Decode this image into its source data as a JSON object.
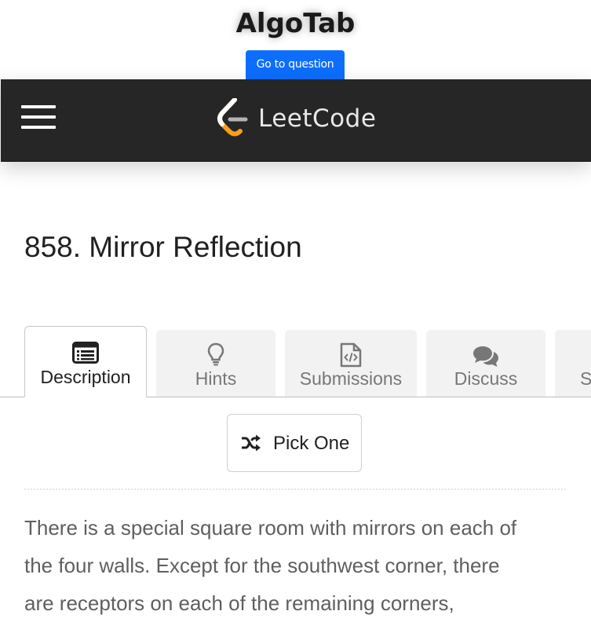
{
  "app": {
    "title": "AlgoTab",
    "goto_label": "Go to question"
  },
  "header": {
    "logo_text": "LeetCode",
    "menu_icon": "hamburger-menu-icon"
  },
  "problem": {
    "title": "858. Mirror Reflection"
  },
  "tabs": [
    {
      "label": "Description",
      "icon": "list-alt-icon",
      "active": true
    },
    {
      "label": "Hints",
      "icon": "lightbulb-icon",
      "active": false
    },
    {
      "label": "Submissions",
      "icon": "file-code-icon",
      "active": false
    },
    {
      "label": "Discuss",
      "icon": "comments-icon",
      "active": false
    },
    {
      "label": "S",
      "icon": "",
      "active": false
    }
  ],
  "pick_one": {
    "label": "Pick One",
    "icon": "shuffle-icon"
  },
  "description": {
    "text": "There is a special square room with mirrors on each of\nthe four walls.  Except for the southwest corner, there\nare receptors on each of the remaining corners,"
  },
  "colors": {
    "primary": "#0d6efd",
    "header_bg": "#262626",
    "logo_orange": "#f89f1b"
  }
}
